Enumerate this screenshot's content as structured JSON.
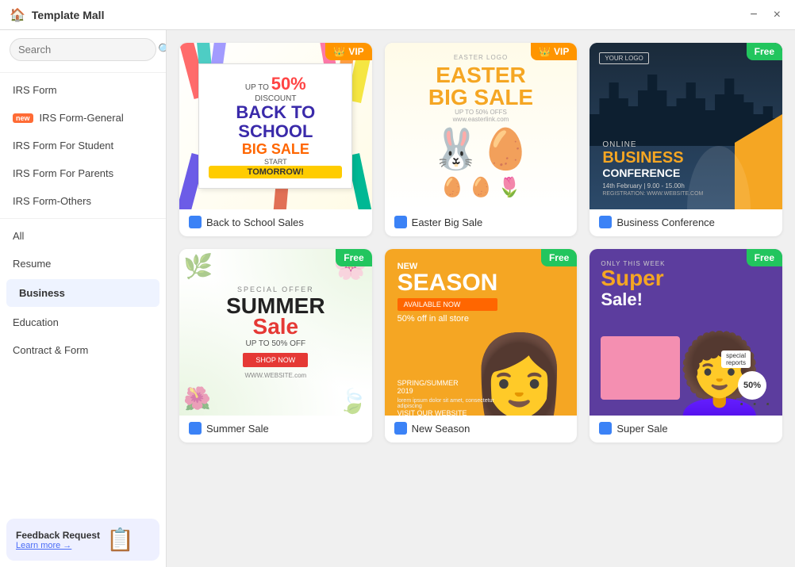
{
  "titleBar": {
    "title": "Template Mall",
    "minimizeLabel": "−",
    "closeLabel": "×"
  },
  "search": {
    "placeholder": "Search"
  },
  "sidebar": {
    "items": [
      {
        "id": "irs-form",
        "label": "IRS Form",
        "active": false,
        "badge": null
      },
      {
        "id": "irs-form-general",
        "label": "IRS Form-General",
        "active": false,
        "badge": "new"
      },
      {
        "id": "irs-form-student",
        "label": "IRS Form For Student",
        "active": false,
        "badge": null
      },
      {
        "id": "irs-form-parents",
        "label": "IRS Form For Parents",
        "active": false,
        "badge": null
      },
      {
        "id": "irs-form-others",
        "label": "IRS Form-Others",
        "active": false,
        "badge": null
      },
      {
        "id": "all",
        "label": "All",
        "active": false,
        "badge": null
      },
      {
        "id": "resume",
        "label": "Resume",
        "active": false,
        "badge": null
      },
      {
        "id": "business",
        "label": "Business",
        "active": true,
        "badge": null
      },
      {
        "id": "education",
        "label": "Education",
        "active": false,
        "badge": null
      },
      {
        "id": "contract-form",
        "label": "Contract & Form",
        "active": false,
        "badge": null
      }
    ]
  },
  "feedback": {
    "label": "Feedback Request",
    "linkText": "Learn more →"
  },
  "templates": [
    {
      "id": "back-to-school",
      "label": "Back to School Sales",
      "badge": "VIP",
      "badgeType": "vip"
    },
    {
      "id": "easter-big-sale",
      "label": "Easter Big Sale",
      "badge": "VIP",
      "badgeType": "vip"
    },
    {
      "id": "business-conference",
      "label": "Business Conference",
      "badge": "Free",
      "badgeType": "free"
    },
    {
      "id": "summer-sale",
      "label": "Summer Sale",
      "badge": "Free",
      "badgeType": "free"
    },
    {
      "id": "new-season",
      "label": "New Season",
      "badge": "Free",
      "badgeType": "free"
    },
    {
      "id": "super-sale",
      "label": "Super Sale",
      "badge": "Free",
      "badgeType": "free"
    }
  ]
}
